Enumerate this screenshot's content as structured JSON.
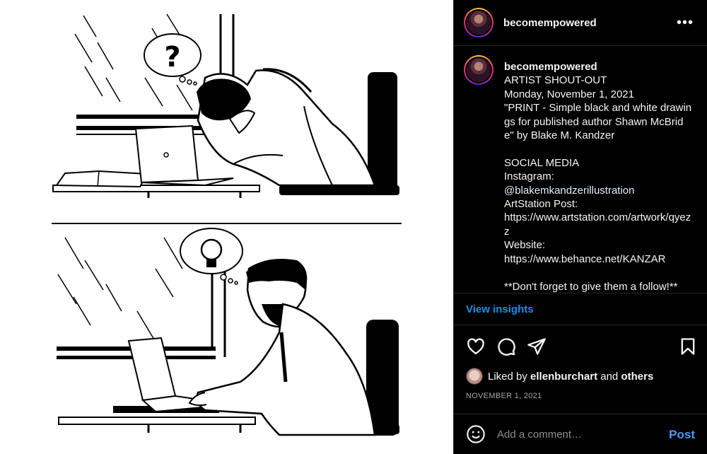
{
  "post": {
    "username": "becomempowered",
    "more_icon": "more-horizontal-icon",
    "caption": {
      "username": "becomempowered",
      "lines_before_link": "ARTIST SHOUT-OUT\nMonday, November 1, 2021\n\"PRINT - Simple black and white drawings for published author Shawn McBride\" by Blake M. Kandzer\n\nSOCIAL MEDIA\nInstagram:",
      "link": "@blakemkandzerillustration",
      "lines_after_link": "ArtStation Post:\nhttps://www.artstation.com/artwork/qyezz\nWebsite:\nhttps://www.behance.net/KANZAR\n\n**Don't forget to give them a follow!**"
    },
    "insights_label": "View insights",
    "liked_prefix": "Liked by",
    "liked_user": "ellenburchart",
    "liked_and": "and",
    "liked_others": "others",
    "date": "NOVEMBER 1, 2021",
    "comment_placeholder": "Add a comment…",
    "post_label": "Post"
  },
  "illustration": {
    "top_thought": "?",
    "bottom_thought": "lightbulb"
  },
  "icons": {
    "like": "heart-icon",
    "comment": "comment-icon",
    "share": "share-icon",
    "save": "bookmark-icon",
    "emoji": "emoji-icon"
  },
  "colors": {
    "background": "#000000",
    "link": "#0095f6",
    "text": "#f5f5f5",
    "muted": "#a8a8a8"
  }
}
